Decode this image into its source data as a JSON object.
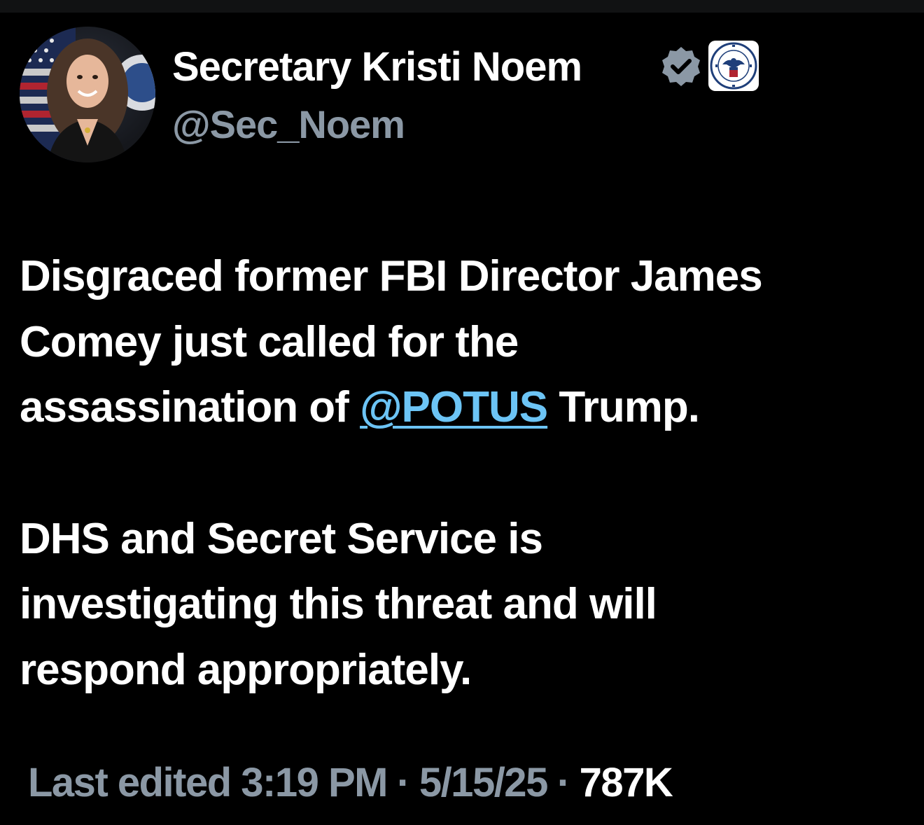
{
  "profile": {
    "display_name": "Secretary Kristi Noem",
    "handle": "@Sec_Noem",
    "avatar_icon": "profile-photo",
    "verified_icon": "verified-badge-icon",
    "affiliation_icon": "dhs-seal-icon"
  },
  "tweet": {
    "para1": {
      "line1": "Disgraced former FBI Director James",
      "line2": "Comey just called for the",
      "line3_prefix": "assassination of ",
      "mention": "@POTUS",
      "line3_suffix": " Trump."
    },
    "para2": {
      "line1": "DHS and Secret Service is",
      "line2": "investigating this threat and will",
      "line3": "respond appropriately."
    }
  },
  "meta": {
    "edited_label": "Last edited 3:19 PM",
    "date": "5/15/25",
    "views_count": "787K",
    "separator": "·"
  },
  "colors": {
    "background": "#000000",
    "text_primary": "#ffffff",
    "text_secondary": "#8b98a5",
    "link": "#6cc4f5",
    "verified": "#8b98a5"
  }
}
